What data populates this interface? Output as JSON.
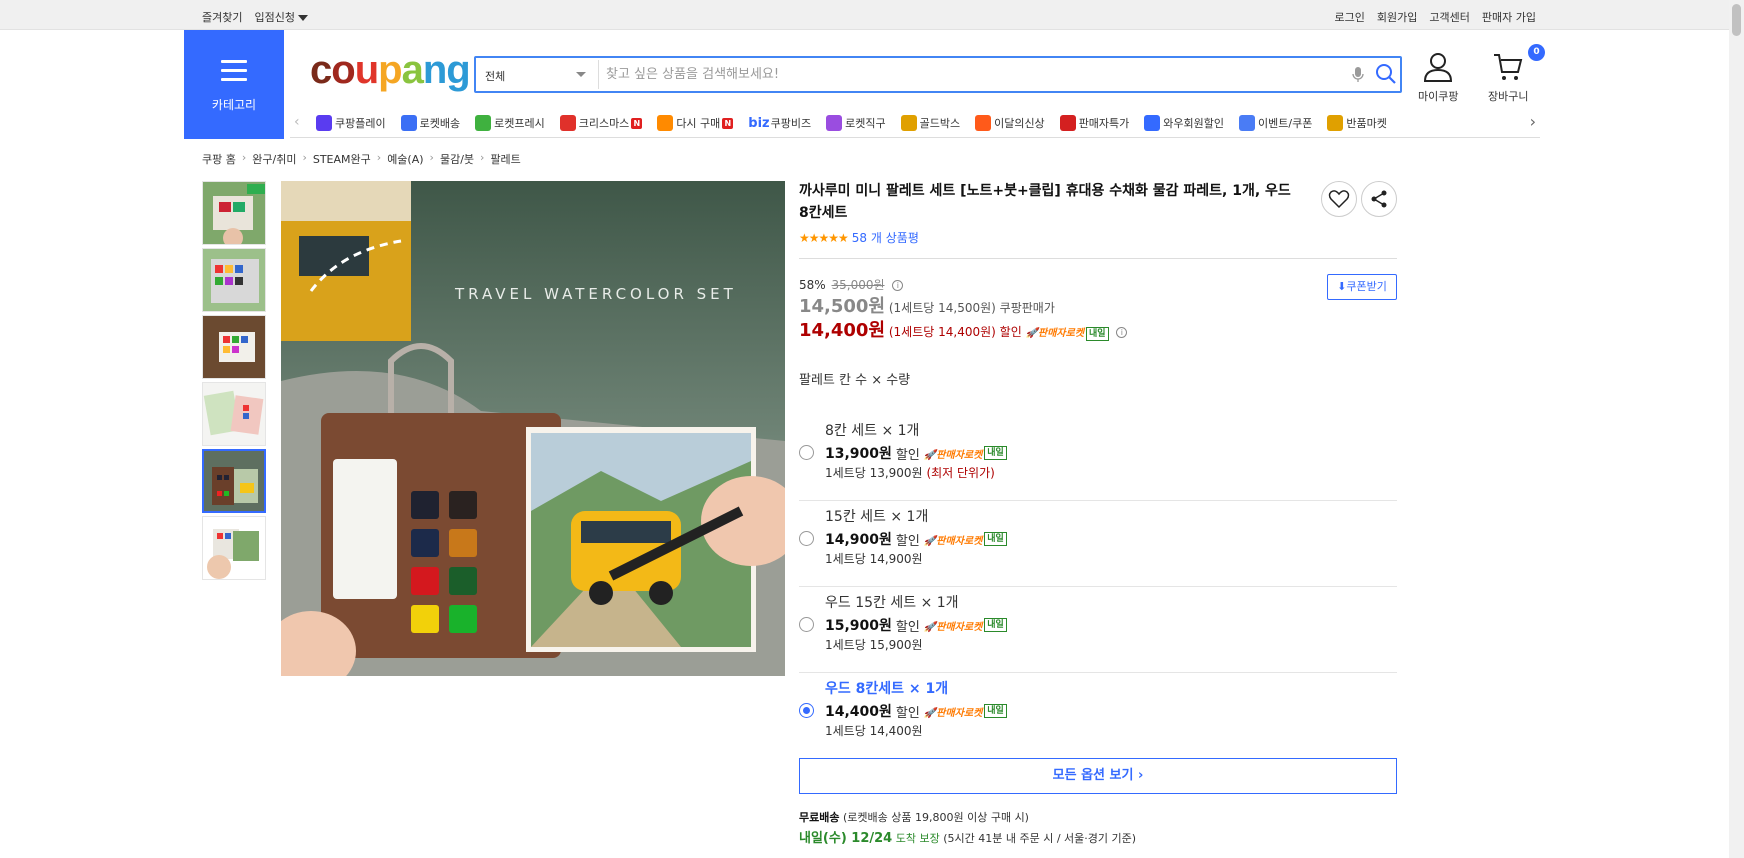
{
  "topbar": {
    "left": [
      "즐겨찾기",
      "입점신청"
    ],
    "right": [
      "로그인",
      "회원가입",
      "고객센터",
      "판매자 가입"
    ]
  },
  "header": {
    "category_label": "카테고리",
    "logo": "coupang",
    "search_category": "전체",
    "search_placeholder": "찾고 싶은 상품을 검색해보세요!",
    "mypage_label": "마이쿠팡",
    "cart_label": "장바구니",
    "cart_count": "0"
  },
  "nav": {
    "items": [
      {
        "label": "쿠팡플레이",
        "color": "#5a3cf0"
      },
      {
        "label": "로켓배송",
        "color": "#3b6ff5"
      },
      {
        "label": "로켓프레시",
        "color": "#3fb13f"
      },
      {
        "label": "크리스마스",
        "color": "#e0312b",
        "badge": "N"
      },
      {
        "label": "다시 구매",
        "color": "#ff8a00",
        "badge": "N"
      },
      {
        "label": "쿠팡비즈",
        "prefix": "biz",
        "color": "#346aff"
      },
      {
        "label": "로켓직구",
        "color": "#9a4de0"
      },
      {
        "label": "골드박스",
        "color": "#e0a000"
      },
      {
        "label": "이달의신상",
        "color": "#ff5a1a"
      },
      {
        "label": "판매자특가",
        "color": "#d42020"
      },
      {
        "label": "와우회원할인",
        "color": "#346aff"
      },
      {
        "label": "이벤트/쿠폰",
        "color": "#4a7cf5"
      },
      {
        "label": "반품마켓",
        "color": "#e0a000"
      }
    ]
  },
  "breadcrumb": [
    "쿠팡 홈",
    "완구/취미",
    "STEAM완구",
    "예술(A)",
    "물감/붓",
    "팔레트"
  ],
  "product": {
    "image_caption": "TRAVEL WATERCOLOR SET",
    "title": "까사루미 미니 팔레트 세트 [노트+붓+클립] 휴대용 수채화 물감 파레트, 1개, 우드 8칸세트",
    "stars": "★★★★★",
    "rating_count": "58 개 상품평",
    "coupon_label": "쿠폰받기",
    "discount_rate": "58%",
    "original_price": "35,000원",
    "seller_price": "14,500원",
    "seller_price_unit": "(1세트당 14,500원)",
    "seller_label": "쿠팡판매가",
    "sale_price": "14,400원",
    "sale_price_unit": "(1세트당 14,400원)",
    "sale_label": "할인",
    "rocket_label": "판매자로켓",
    "tomorrow_label": "내일",
    "option_label": "팔레트 칸 수 × 수량",
    "options": [
      {
        "name": "8칸 세트 × 1개",
        "price": "13,900원",
        "disc": "할인",
        "unit": "1세트당 13,900원",
        "note": "(최저 단위가)",
        "selected": false
      },
      {
        "name": "15칸 세트 × 1개",
        "price": "14,900원",
        "disc": "할인",
        "unit": "1세트당 14,900원",
        "note": "",
        "selected": false
      },
      {
        "name": "우드 15칸 세트 × 1개",
        "price": "15,900원",
        "disc": "할인",
        "unit": "1세트당 15,900원",
        "note": "",
        "selected": false
      },
      {
        "name": "우드 8칸세트 × 1개",
        "price": "14,400원",
        "disc": "할인",
        "unit": "1세트당 14,400원",
        "note": "",
        "selected": true
      }
    ],
    "all_options_label": "모든 옵션 보기 ›",
    "shipping_free": "무료배송",
    "shipping_free_note": "(로켓배송 상품 19,800원 이상 구매 시)",
    "delivery_date": "내일(수) 12/24",
    "delivery_guarantee": "도착 보장",
    "delivery_note": "(5시간 41분 내 주문 시 / 서울·경기 기준)"
  }
}
